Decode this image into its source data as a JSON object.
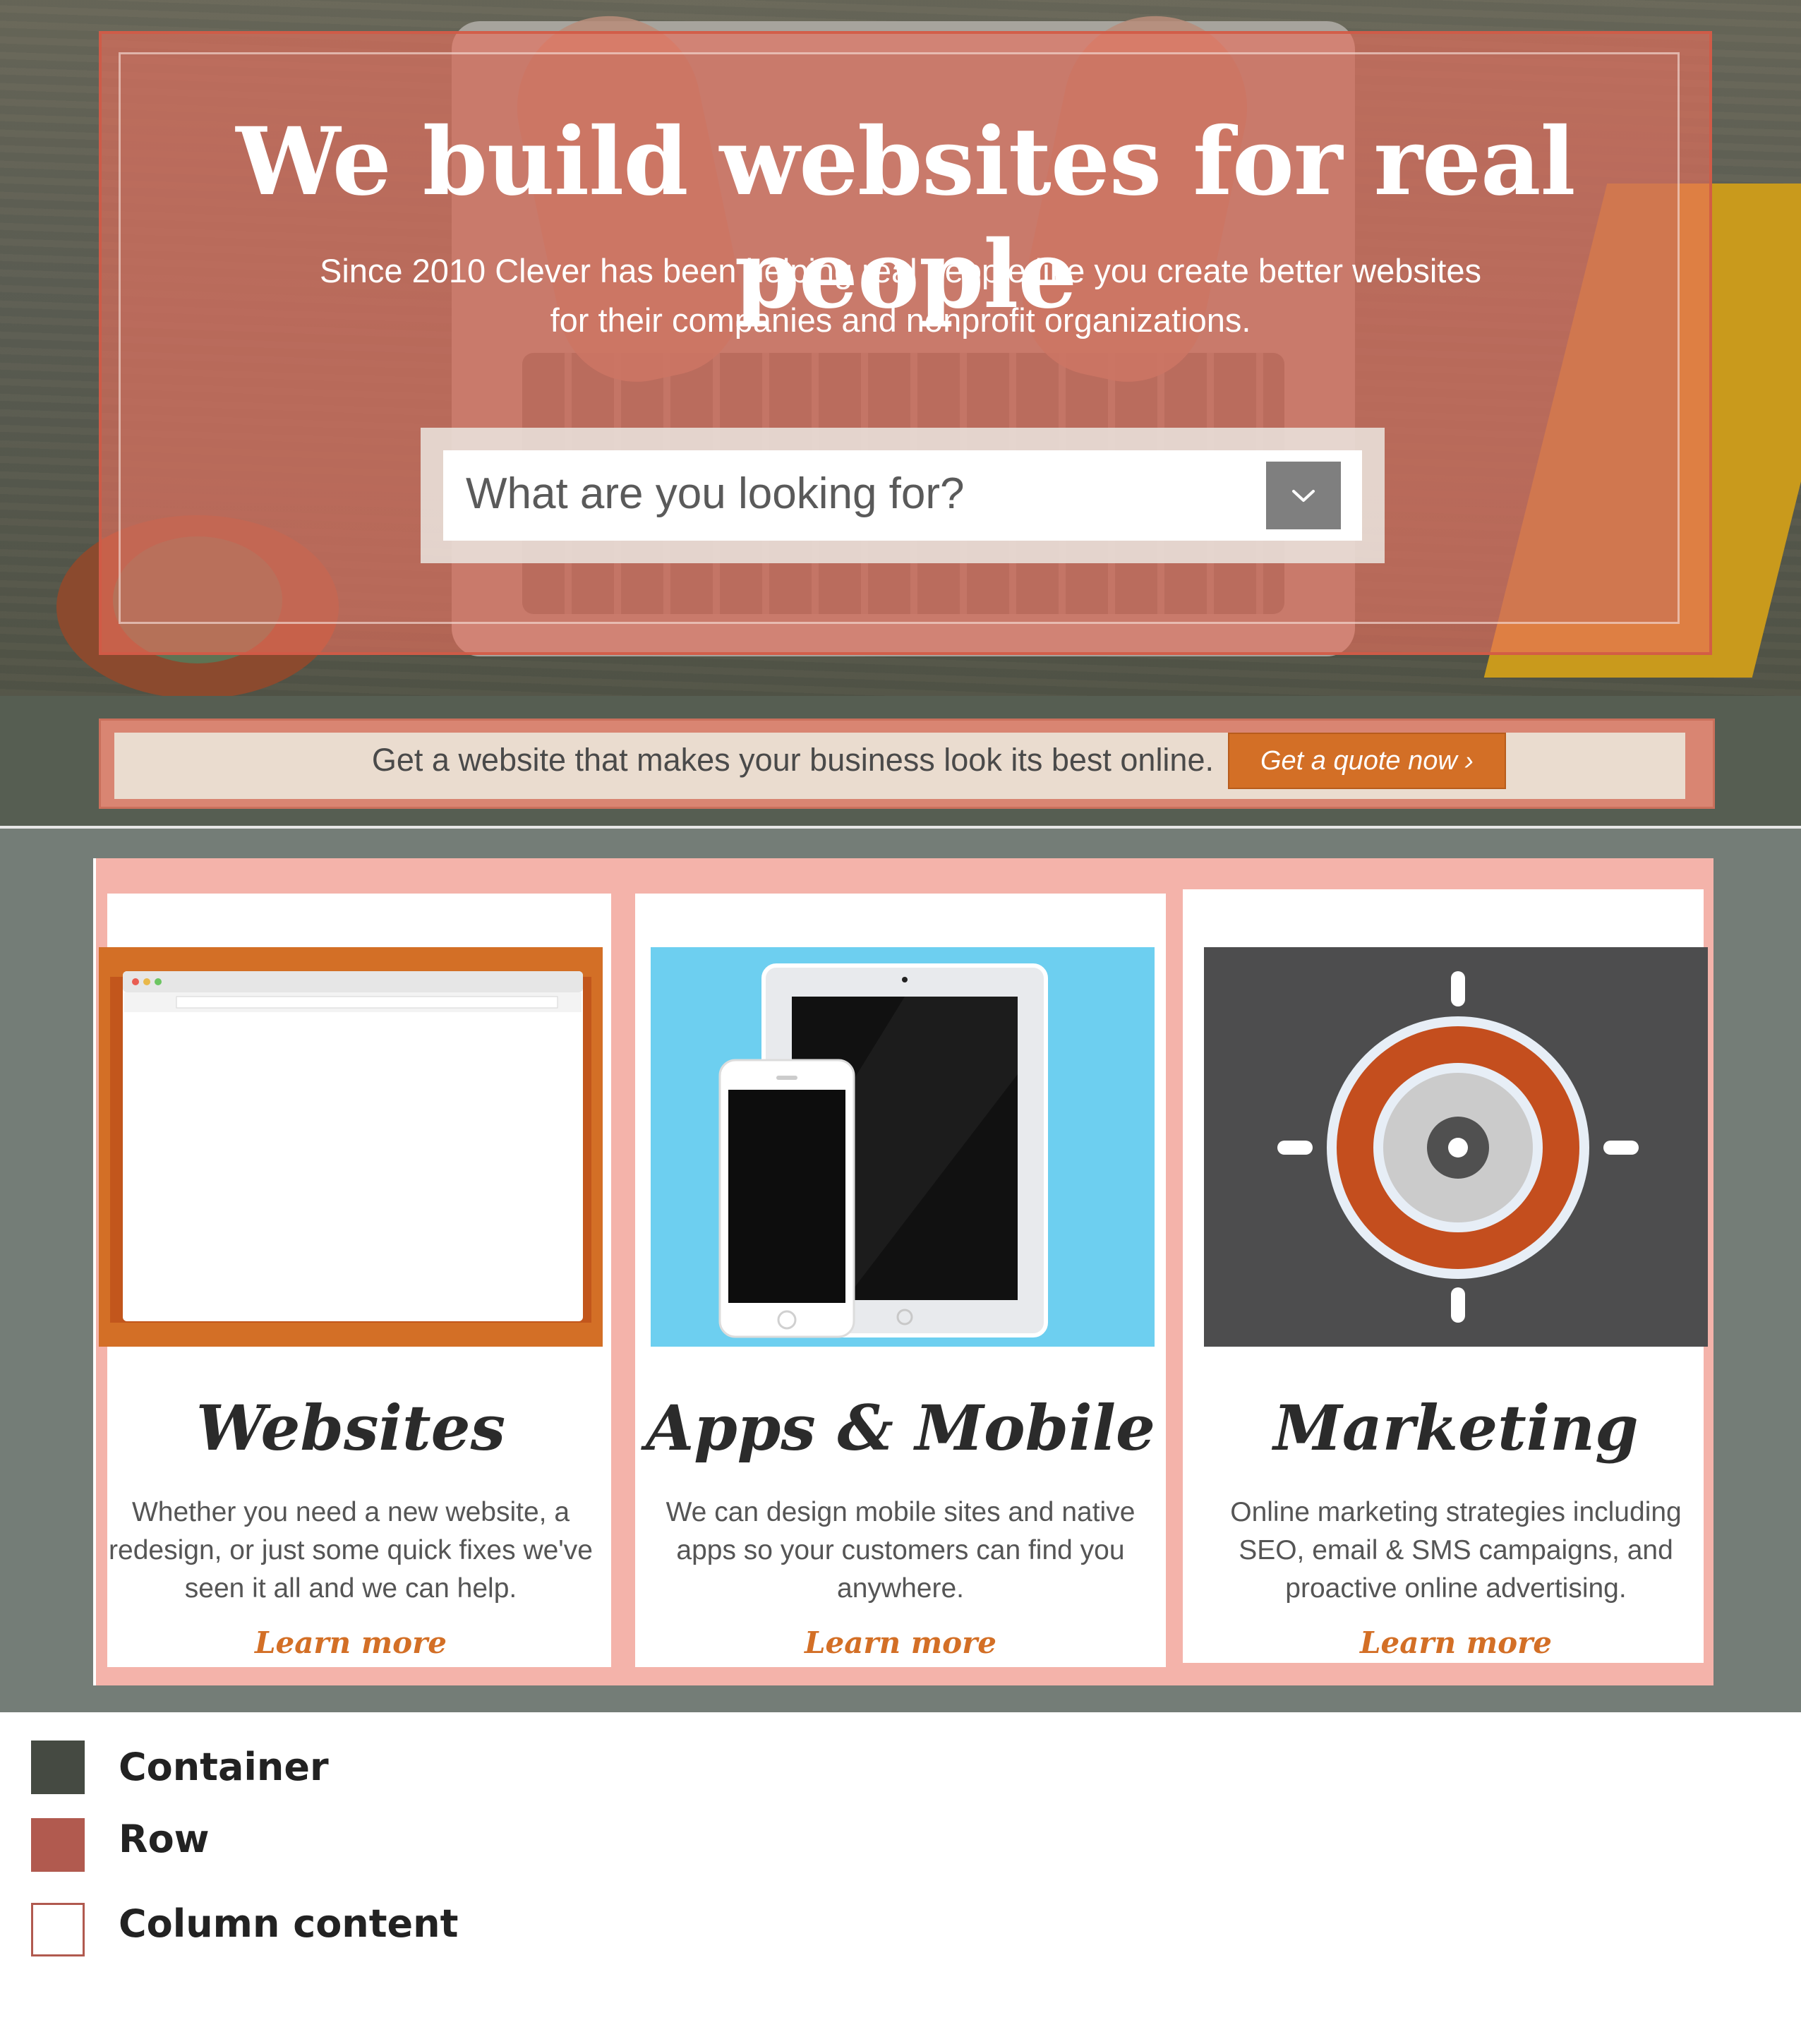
{
  "hero": {
    "title": "We build websites for real people",
    "subtitle_line1": "Since 2010 Clever has been helping real people like you create better websites",
    "subtitle_line2": "for their companies and nonprofit organizations.",
    "search": {
      "placeholder": "What are you looking for?"
    }
  },
  "cta": {
    "text": "Get a website that makes your business look its best online.",
    "button_label": "Get a quote now ›"
  },
  "services": [
    {
      "title": "Websites",
      "desc_line1": "Whether you need a new website, a",
      "desc_line2": "redesign, or just some quick fixes we've",
      "desc_line3": "seen it all and we can help.",
      "link": "Learn more"
    },
    {
      "title": "Apps & Mobile",
      "desc_line1": "We can design mobile sites and native",
      "desc_line2": "apps so your customers can find you",
      "desc_line3": "anywhere.",
      "link": "Learn more"
    },
    {
      "title": "Marketing",
      "desc_line1": "Online marketing strategies including",
      "desc_line2": "SEO, email & SMS campaigns, and",
      "desc_line3": "proactive online advertising.",
      "link": "Learn more"
    }
  ],
  "legend": [
    {
      "label": "Container",
      "color": "#454a42"
    },
    {
      "label": "Row",
      "color": "#b15a4f"
    },
    {
      "label": "Column content",
      "color": "#ffffff"
    }
  ],
  "colors": {
    "accent": "#d36f26",
    "container": "#454a42",
    "row": "#b15a4f"
  },
  "icons": [
    "chevron-down-icon",
    "browser-window-icon",
    "mobile-devices-icon",
    "target-icon"
  ]
}
